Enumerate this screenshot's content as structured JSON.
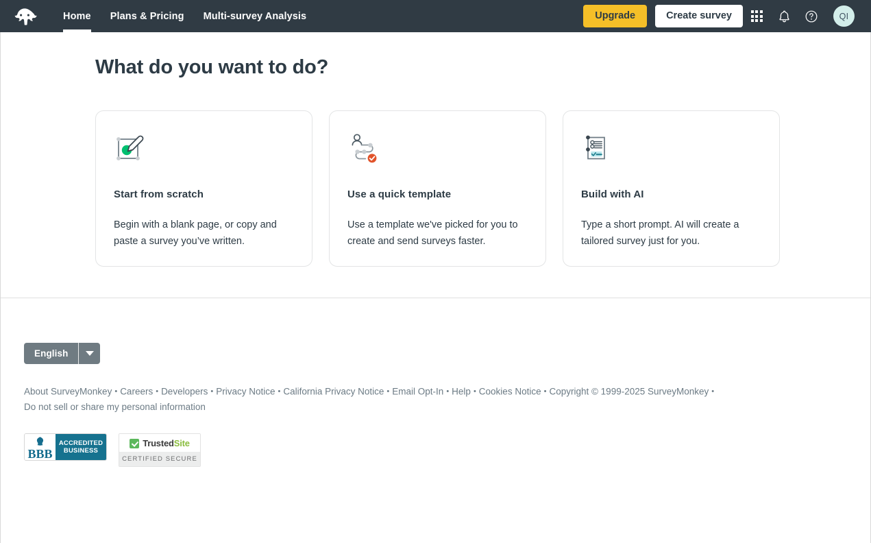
{
  "header": {
    "logo_name": "surveymonkey-logo",
    "nav": [
      {
        "label": "Home",
        "active": true
      },
      {
        "label": "Plans & Pricing",
        "active": false
      },
      {
        "label": "Multi-survey Analysis",
        "active": false
      }
    ],
    "upgrade_label": "Upgrade",
    "create_survey_label": "Create survey",
    "apps_icon": "grid-apps-icon",
    "notifications_icon": "bell-icon",
    "help_icon": "question-circle-icon",
    "avatar_initials": "QI",
    "colors": {
      "bar_background": "#303b44",
      "upgrade_background": "#f5bf28",
      "avatar_background": "#d3eeea"
    }
  },
  "main": {
    "page_title": "What do you want to do?",
    "cards": [
      {
        "icon": "pencil-square-icon",
        "title": "Start from scratch",
        "description": "Begin with a blank page, or copy and paste a survey you’ve written."
      },
      {
        "icon": "person-path-check-icon",
        "title": "Use a quick template",
        "description": "Use a template we've picked for you to create and send surveys faster."
      },
      {
        "icon": "form-checklist-icon",
        "title": "Build with AI",
        "description": "Type a short prompt. AI will create a tailored survey just for you."
      }
    ]
  },
  "footer": {
    "language": "English",
    "links": [
      "About SurveyMonkey",
      "Careers",
      "Developers",
      "Privacy Notice",
      "California Privacy Notice",
      "Email Opt-In",
      "Help",
      "Cookies Notice",
      "Copyright © 1999-2025 SurveyMonkey",
      "Do not sell or share my personal information"
    ],
    "separator": "•",
    "badges": {
      "bbb": {
        "mark": "BBB",
        "line1": "ACCREDITED",
        "line2": "BUSINESS"
      },
      "trustedsite": {
        "name_primary": "Trusted",
        "name_secondary": "Site",
        "caption": "CERTIFIED SECURE"
      }
    }
  }
}
